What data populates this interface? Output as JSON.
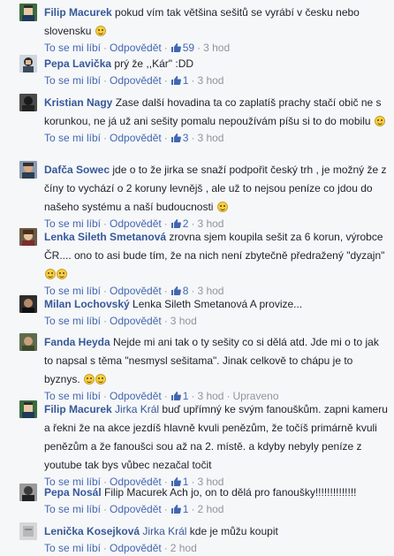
{
  "ui": {
    "like_label": "To se mi líbí",
    "reply_label": "Odpovědět",
    "separator": "·"
  },
  "comments": [
    {
      "author": "Filip Macurek",
      "text": "pokud vím tak většina sešitů se vyrábí v česku nebo slovensku",
      "likes": "59",
      "time": "3 hod"
    },
    {
      "author": "Pepa Lavička",
      "text": "prý že ,,Kár\" :DD",
      "likes": "1",
      "time": "3 hod"
    },
    {
      "author": "Kristian Nagy",
      "text": "Zase další hovadina ta co zaplatíš prachy stačí obič ne s korunkou, ne já už ani sešity pomalu nepoužívám píšu si to do mobilu",
      "likes": "3",
      "time": "3 hod"
    },
    {
      "author": "Dafča Sowec",
      "text": "jde o to že jirka se snaží podpořit český trh , je možný že z číny to vychází o 2 koruny levnějš , ale už to nejsou peníze co jdou do našeho systému a naší budoucnosti",
      "likes": "2",
      "time": "3 hod"
    },
    {
      "author": "Lenka Sileth Smetanová",
      "text": "zrovna sjem koupila sešit za 6 korun, výrobce ČR.... ono to asi bude tím, že na nich není zbytečně předražený \"dyzajn\"",
      "likes": "8",
      "time": "3 hod"
    },
    {
      "author": "Milan Lochovský",
      "text": "Lenka Sileth Smetanová A provize...",
      "time": "3 hod"
    },
    {
      "author": "Fanda Heyda",
      "text": "Nejde mi ani tak o ty sešity co si dělá atd. Jde mi o to jak to napsal s těma \"nesmysl sešitama\". Jinak celkově to chápu je to byznys.",
      "likes": "1",
      "time": "3 hod",
      "edited": "Upraveno"
    },
    {
      "author": "Filip Macurek",
      "mention": "Jirka Král",
      "text": "buď upřímný ke svým fanouškům. zapni kameru a řekni že na akce jezdíš hlavně kvuli penězům, že točíš primárně kvuli penězům a že fanoušci sou až na 2. místě. a kdyby nebyly peníze z youtube tak bys vůbec nezačal točit",
      "likes": "1",
      "time": "3 hod"
    },
    {
      "author": "Pepa Nosál",
      "text": "Filip Macurek Ach jo, on to dělá pro fanoušky!!!!!!!!!!!!!!",
      "likes": "1",
      "time": "2 hod"
    },
    {
      "author": "Lenička Kosejková",
      "mention": "Jirka Král",
      "text": "kde je můžu koupit",
      "time": "2 hod"
    }
  ]
}
